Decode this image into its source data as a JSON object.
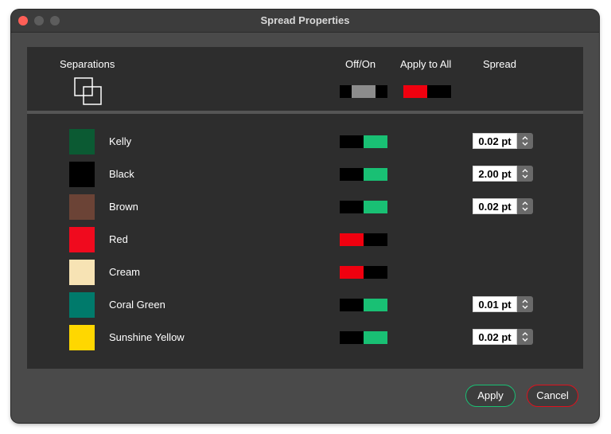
{
  "window": {
    "title": "Spread Properties"
  },
  "header": {
    "separations_label": "Separations",
    "offon_label": "Off/On",
    "apply_all_label": "Apply to All",
    "spread_label": "Spread",
    "separations_icon": "overlapping-squares-icon",
    "offon_state": "mixed",
    "apply_all_state": "off"
  },
  "colors": {
    "on": "#19c074",
    "off": "#f0000f",
    "panel": "#2d2d2d"
  },
  "separations": [
    {
      "name": "Kelly",
      "swatch": "#0b5a33",
      "state": "on",
      "spread": "0.02 pt"
    },
    {
      "name": "Black",
      "swatch": "#000000",
      "state": "on",
      "spread": "2.00 pt"
    },
    {
      "name": "Brown",
      "swatch": "#6b4336",
      "state": "on",
      "spread": "0.02 pt"
    },
    {
      "name": "Red",
      "swatch": "#f00a1e",
      "state": "off",
      "spread": ""
    },
    {
      "name": "Cream",
      "swatch": "#f7e3b4",
      "state": "off",
      "spread": ""
    },
    {
      "name": "Coral Green",
      "swatch": "#007a6b",
      "state": "on",
      "spread": "0.01 pt"
    },
    {
      "name": "Sunshine Yellow",
      "swatch": "#ffd700",
      "state": "on",
      "spread": "0.02 pt"
    }
  ],
  "buttons": {
    "apply_label": "Apply",
    "cancel_label": "Cancel"
  }
}
